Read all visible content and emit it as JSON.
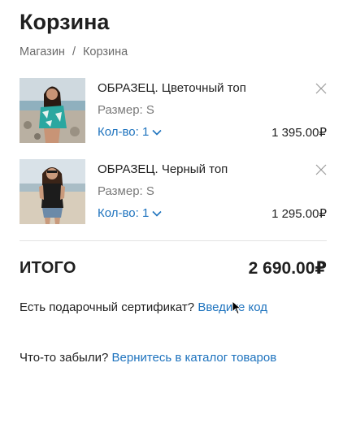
{
  "page": {
    "title": "Корзина"
  },
  "breadcrumb": {
    "shop": "Магазин",
    "separator": "/",
    "current": "Корзина"
  },
  "cart": {
    "items": [
      {
        "name": "ОБРАЗЕЦ. Цветочный топ",
        "size": "Размер: S",
        "qty_label": "Кол-во: 1",
        "price": "1 395.00₽",
        "photo": "woman-on-beach-floral-top-photo"
      },
      {
        "name": "ОБРАЗЕЦ. Черный топ",
        "size": "Размер: S",
        "qty_label": "Кол-во: 1",
        "price": "1 295.00₽",
        "photo": "woman-on-beach-black-top-photo"
      }
    ],
    "total_label": "ИТОГО",
    "total_value": "2 690.00₽"
  },
  "gift": {
    "question": "Есть подарочный сертификат?",
    "link": "Введите код"
  },
  "forgot": {
    "question": "Что-то забыли?",
    "link": "Вернитесь в каталог товаров"
  },
  "icons": {
    "remove": "close-icon",
    "qty": "chevron-down-icon",
    "pointer": "mouse-cursor-icon"
  },
  "colors": {
    "link": "#1e73be",
    "text": "#1f1f1f",
    "muted": "#7a7a7a",
    "divider": "#e3e3e3"
  }
}
